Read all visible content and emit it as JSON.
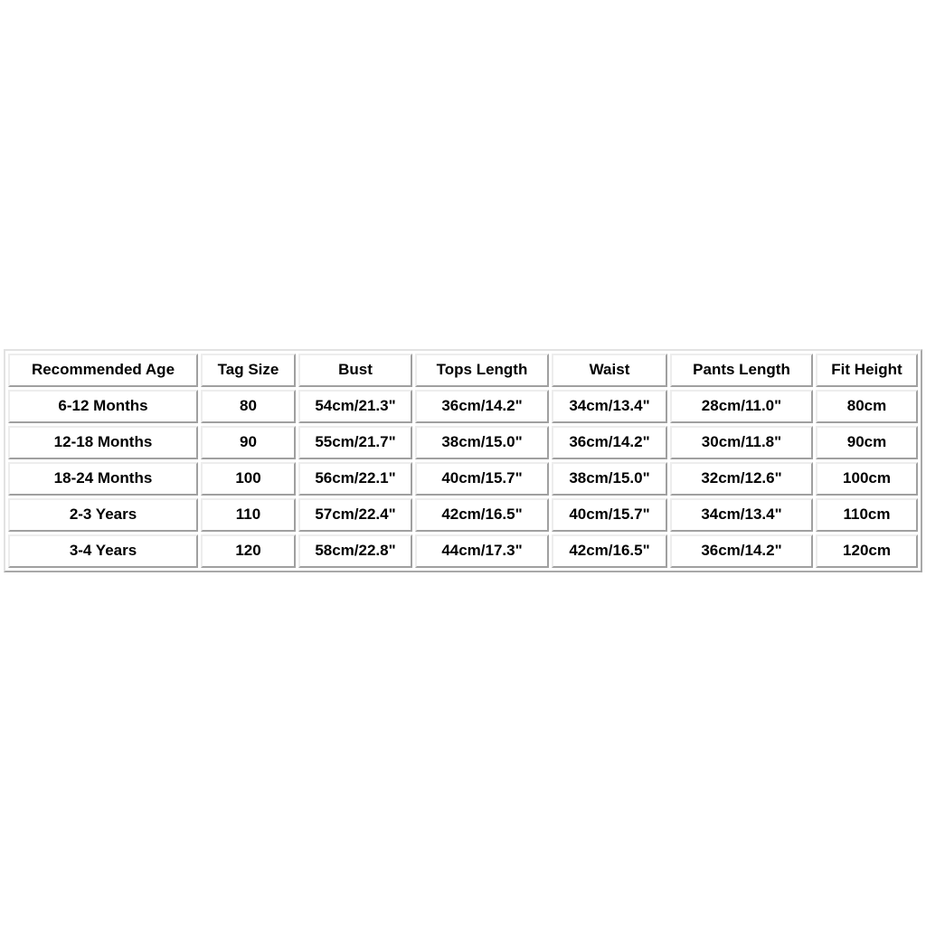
{
  "page": {
    "background_color": "#ffffff",
    "text_color": "#000000",
    "border_color": "#c0c0c0"
  },
  "chart_data": {
    "type": "table",
    "title": "",
    "columns": [
      "Recommended Age",
      "Tag Size",
      "Bust",
      "Tops Length",
      "Waist",
      "Pants Length",
      "Fit Height"
    ],
    "rows": [
      {
        "recommended_age": "6-12 Months",
        "tag_size": "80",
        "bust": "54cm/21.3\"",
        "tops_length": "36cm/14.2\"",
        "waist": "34cm/13.4\"",
        "pants_length": "28cm/11.0\"",
        "fit_height": "80cm"
      },
      {
        "recommended_age": "12-18 Months",
        "tag_size": "90",
        "bust": "55cm/21.7\"",
        "tops_length": "38cm/15.0\"",
        "waist": "36cm/14.2\"",
        "pants_length": "30cm/11.8\"",
        "fit_height": "90cm"
      },
      {
        "recommended_age": "18-24 Months",
        "tag_size": "100",
        "bust": "56cm/22.1\"",
        "tops_length": "40cm/15.7\"",
        "waist": "38cm/15.0\"",
        "pants_length": "32cm/12.6\"",
        "fit_height": "100cm"
      },
      {
        "recommended_age": "2-3 Years",
        "tag_size": "110",
        "bust": "57cm/22.4\"",
        "tops_length": "42cm/16.5\"",
        "waist": "40cm/15.7\"",
        "pants_length": "34cm/13.4\"",
        "fit_height": "110cm"
      },
      {
        "recommended_age": "3-4 Years",
        "tag_size": "120",
        "bust": "58cm/22.8\"",
        "tops_length": "44cm/17.3\"",
        "waist": "42cm/16.5\"",
        "pants_length": "36cm/14.2\"",
        "fit_height": "120cm"
      }
    ]
  }
}
